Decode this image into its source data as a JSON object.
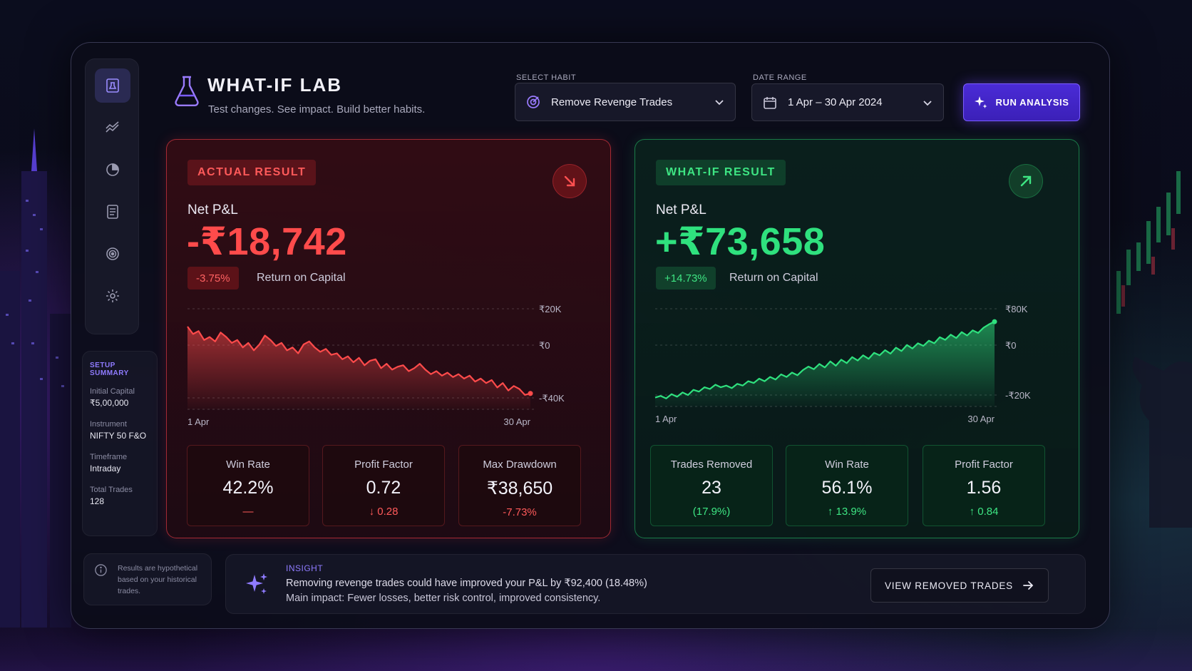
{
  "header": {
    "title": "WHAT-IF LAB",
    "subtitle": "Test changes. See impact. Build better habits."
  },
  "controls": {
    "habit_label": "SELECT HABIT",
    "habit_value": "Remove Revenge Trades",
    "date_label": "DATE RANGE",
    "date_value": "1 Apr – 30 Apr 2024",
    "run_label": "RUN ANALYSIS"
  },
  "sidebar": {
    "items": [
      {
        "icon": "lab-icon",
        "active": true
      },
      {
        "icon": "trend-chart-icon",
        "active": false
      },
      {
        "icon": "pie-chart-icon",
        "active": false
      },
      {
        "icon": "journal-icon",
        "active": false
      },
      {
        "icon": "target-icon",
        "active": false
      },
      {
        "icon": "gear-icon",
        "active": false
      }
    ]
  },
  "summary": {
    "title": "SETUP SUMMARY",
    "items": [
      {
        "label": "Initial Capital",
        "value": "₹5,00,000"
      },
      {
        "label": "Instrument",
        "value": "NIFTY 50 F&O"
      },
      {
        "label": "Timeframe",
        "value": "Intraday"
      },
      {
        "label": "Total Trades",
        "value": "128"
      }
    ]
  },
  "disclaimer": "Results are hypothetical based on your historical trades.",
  "actual": {
    "badge": "ACTUAL RESULT",
    "pnl_label": "Net P&L",
    "pnl_value": "-₹18,742",
    "roc_pill": "-3.75%",
    "roc_label": "Return on Capital",
    "stats": [
      {
        "label": "Win Rate",
        "value": "42.2%",
        "sub": "—"
      },
      {
        "label": "Profit Factor",
        "value": "0.72",
        "sub": "↓ 0.28"
      },
      {
        "label": "Max Drawdown",
        "value": "₹38,650",
        "sub": "-7.73%"
      }
    ],
    "color": "#ff4b4b"
  },
  "whatif": {
    "badge": "WHAT-IF RESULT",
    "pnl_label": "Net P&L",
    "pnl_value": "+₹73,658",
    "roc_pill": "+14.73%",
    "roc_label": "Return on Capital",
    "stats": [
      {
        "label": "Trades Removed",
        "value": "23",
        "sub": "(17.9%)"
      },
      {
        "label": "Win Rate",
        "value": "56.1%",
        "sub": "↑ 13.9%"
      },
      {
        "label": "Profit Factor",
        "value": "1.56",
        "sub": "↑ 0.84"
      }
    ],
    "color": "#2fe17e"
  },
  "insight": {
    "title": "INSIGHT",
    "line1": "Removing revenge trades could have improved your P&L by ₹92,400 (18.48%)",
    "line2": "Main impact: Fewer losses, better risk control, improved consistency.",
    "button": "VIEW REMOVED TRADES"
  },
  "chart_data": [
    {
      "type": "area",
      "x_start": "1 Apr",
      "x_end": "30 Apr",
      "x_tick_labels": [
        "1 Apr",
        "30 Apr"
      ],
      "y_tick_labels": [
        "₹20K",
        "₹0",
        "-₹40K"
      ],
      "y_ticks": [
        20000,
        0,
        -40000
      ],
      "color": "#ff4b4b",
      "values": [
        8000,
        3000,
        5000,
        -1000,
        1000,
        -2000,
        4000,
        1000,
        -3000,
        -1000,
        -6000,
        -3000,
        -8000,
        -4000,
        2000,
        -1000,
        -5000,
        -3000,
        -8000,
        -6000,
        -10000,
        -4000,
        -2000,
        -6000,
        -9000,
        -7000,
        -11000,
        -10000,
        -14000,
        -12000,
        -16000,
        -13000,
        -18000,
        -15000,
        -14000,
        -20000,
        -17000,
        -21000,
        -19000,
        -18000,
        -22000,
        -20000,
        -17000,
        -21000,
        -24000,
        -22000,
        -25000,
        -23000,
        -26000,
        -24000,
        -27000,
        -25000,
        -29000,
        -27000,
        -30000,
        -28000,
        -33000,
        -30000,
        -35000,
        -32000,
        -34000,
        -38000,
        -37000
      ]
    },
    {
      "type": "area",
      "x_start": "1 Apr",
      "x_end": "30 Apr",
      "x_tick_labels": [
        "1 Apr",
        "30 Apr"
      ],
      "y_tick_labels": [
        "₹80K",
        "₹0",
        "-₹20K"
      ],
      "y_ticks": [
        80000,
        0,
        -20000
      ],
      "color": "#2fe17e",
      "values": [
        -23000,
        -21000,
        -24000,
        -19000,
        -22000,
        -17000,
        -20000,
        -14000,
        -16000,
        -11000,
        -13000,
        -8000,
        -11000,
        -9000,
        -12000,
        -7000,
        -9000,
        -4000,
        -6000,
        -1000,
        -4000,
        1000,
        -2000,
        4000,
        1000,
        6000,
        3000,
        9000,
        13000,
        10000,
        16000,
        12000,
        19000,
        14000,
        21000,
        17000,
        24000,
        20000,
        26000,
        22000,
        29000,
        26000,
        32000,
        28000,
        35000,
        31000,
        38000,
        34000,
        40000,
        37000,
        43000,
        40000,
        47000,
        44000,
        50000,
        46000,
        53000,
        49000,
        55000,
        52000,
        58000,
        62000,
        65000
      ]
    }
  ]
}
